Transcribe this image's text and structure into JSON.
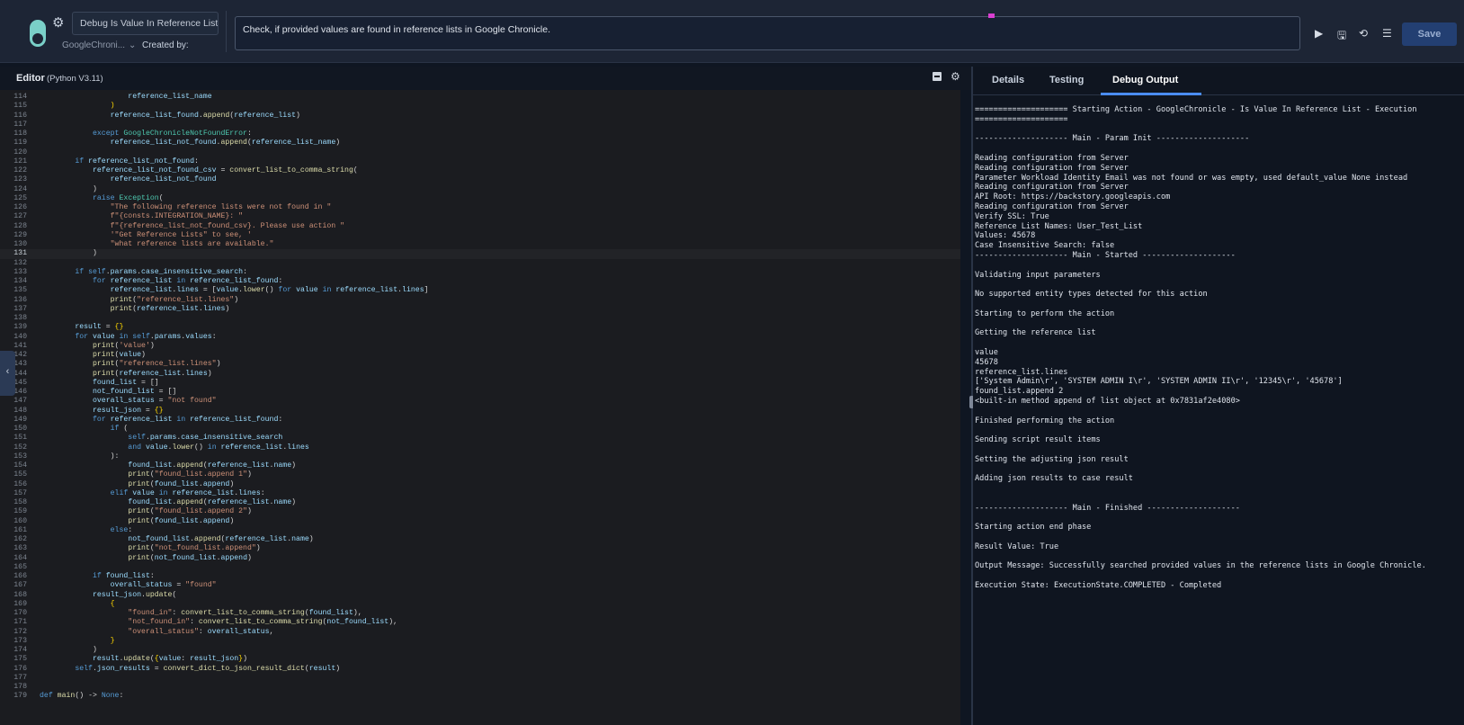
{
  "header": {
    "action_name": "Debug Is Value In Reference List",
    "integration": "GoogleChroni...",
    "created_by_label": "Created by:",
    "description": "Check, if provided values are found in reference lists in Google Chronicle.",
    "save_label": "Save",
    "icons": [
      "play-icon",
      "save-icon",
      "history-icon",
      "list-icon",
      "gear-icon",
      "chevron-down-icon"
    ]
  },
  "editor": {
    "title": "Editor",
    "subtitle": "(Python V3.11)",
    "code": [
      {
        "n": "114",
        "h": "                    <span class=\"vr\">reference_list_name</span>"
      },
      {
        "n": "115",
        "h": "                <span class=\"br\">)</span>"
      },
      {
        "n": "116",
        "h": "                <span class=\"vr\">reference_list_found</span>.<span class=\"fn\">append</span>(<span class=\"vr\">reference_list</span>)"
      },
      {
        "n": "117",
        "h": ""
      },
      {
        "n": "118",
        "h": "            <span class=\"kw\">except</span> <span class=\"cls\">GoogleChronicleNotFoundError</span>:"
      },
      {
        "n": "119",
        "h": "                <span class=\"vr\">reference_list_not_found</span>.<span class=\"fn\">append</span>(<span class=\"vr\">reference_list_name</span>)"
      },
      {
        "n": "120",
        "h": ""
      },
      {
        "n": "121",
        "h": "        <span class=\"kw\">if</span> <span class=\"vr\">reference_list_not_found</span>:"
      },
      {
        "n": "122",
        "h": "            <span class=\"vr\">reference_list_not_found_csv</span> = <span class=\"fn\">convert_list_to_comma_string</span>("
      },
      {
        "n": "123",
        "h": "                <span class=\"vr\">reference_list_not_found</span>"
      },
      {
        "n": "124",
        "h": "            )"
      },
      {
        "n": "125",
        "h": "            <span class=\"kw\">raise</span> <span class=\"cls\">Exception</span>("
      },
      {
        "n": "126",
        "h": "                <span class=\"st\">\"The following reference lists were not found in \"</span>"
      },
      {
        "n": "127",
        "h": "                <span class=\"st\">f\"{consts.INTEGRATION_NAME}: \"</span>"
      },
      {
        "n": "128",
        "h": "                <span class=\"st\">f\"{reference_list_not_found_csv}. Please use action \"</span>"
      },
      {
        "n": "129",
        "h": "                <span class=\"st\">'\"Get Reference Lists\" to see, '</span>"
      },
      {
        "n": "130",
        "h": "                <span class=\"st\">\"what reference lists are available.\"</span>"
      },
      {
        "n": "131",
        "h": "            )",
        "active": true
      },
      {
        "n": "132",
        "h": ""
      },
      {
        "n": "133",
        "h": "        <span class=\"kw\">if</span> <span class=\"kw\">self</span>.<span class=\"vr\">params</span>.<span class=\"vr\">case_insensitive_search</span>:"
      },
      {
        "n": "134",
        "h": "            <span class=\"kw\">for</span> <span class=\"vr\">reference_list</span> <span class=\"kw\">in</span> <span class=\"vr\">reference_list_found</span>:"
      },
      {
        "n": "135",
        "h": "                <span class=\"vr\">reference_list</span>.<span class=\"vr\">lines</span> = [<span class=\"vr\">value</span>.<span class=\"fn\">lower</span>() <span class=\"kw\">for</span> <span class=\"vr\">value</span> <span class=\"kw\">in</span> <span class=\"vr\">reference_list</span>.<span class=\"vr\">lines</span>]"
      },
      {
        "n": "136",
        "h": "                <span class=\"fn\">print</span>(<span class=\"st\">\"reference_list.lines\"</span>)"
      },
      {
        "n": "137",
        "h": "                <span class=\"fn\">print</span>(<span class=\"vr\">reference_list</span>.<span class=\"vr\">lines</span>)"
      },
      {
        "n": "138",
        "h": ""
      },
      {
        "n": "139",
        "h": "        <span class=\"vr\">result</span> = <span class=\"br\">{}</span>"
      },
      {
        "n": "140",
        "h": "        <span class=\"kw\">for</span> <span class=\"vr\">value</span> <span class=\"kw\">in</span> <span class=\"kw\">self</span>.<span class=\"vr\">params</span>.<span class=\"vr\">values</span>:"
      },
      {
        "n": "141",
        "h": "            <span class=\"fn\">print</span>(<span class=\"st\">'value'</span>)"
      },
      {
        "n": "142",
        "h": "            <span class=\"fn\">print</span>(<span class=\"vr\">value</span>)"
      },
      {
        "n": "143",
        "h": "            <span class=\"fn\">print</span>(<span class=\"st\">\"reference_list.lines\"</span>)"
      },
      {
        "n": "144",
        "h": "            <span class=\"fn\">print</span>(<span class=\"vr\">reference_list</span>.<span class=\"vr\">lines</span>)"
      },
      {
        "n": "145",
        "h": "            <span class=\"vr\">found_list</span> = []"
      },
      {
        "n": "146",
        "h": "            <span class=\"vr\">not_found_list</span> = []"
      },
      {
        "n": "147",
        "h": "            <span class=\"vr\">overall_status</span> = <span class=\"st\">\"not found\"</span>"
      },
      {
        "n": "148",
        "h": "            <span class=\"vr\">result_json</span> = <span class=\"br\">{}</span>"
      },
      {
        "n": "149",
        "h": "            <span class=\"kw\">for</span> <span class=\"vr\">reference_list</span> <span class=\"kw\">in</span> <span class=\"vr\">reference_list_found</span>:"
      },
      {
        "n": "150",
        "h": "                <span class=\"kw\">if</span> ("
      },
      {
        "n": "151",
        "h": "                    <span class=\"kw\">self</span>.<span class=\"vr\">params</span>.<span class=\"vr\">case_insensitive_search</span>"
      },
      {
        "n": "152",
        "h": "                    <span class=\"kw\">and</span> <span class=\"vr\">value</span>.<span class=\"fn\">lower</span>() <span class=\"kw\">in</span> <span class=\"vr\">reference_list</span>.<span class=\"vr\">lines</span>"
      },
      {
        "n": "153",
        "h": "                ):"
      },
      {
        "n": "154",
        "h": "                    <span class=\"vr\">found_list</span>.<span class=\"fn\">append</span>(<span class=\"vr\">reference_list</span>.<span class=\"vr\">name</span>)"
      },
      {
        "n": "155",
        "h": "                    <span class=\"fn\">print</span>(<span class=\"st\">\"found_list.append 1\"</span>)"
      },
      {
        "n": "156",
        "h": "                    <span class=\"fn\">print</span>(<span class=\"vr\">found_list</span>.<span class=\"vr\">append</span>)"
      },
      {
        "n": "157",
        "h": "                <span class=\"kw\">elif</span> <span class=\"vr\">value</span> <span class=\"kw\">in</span> <span class=\"vr\">reference_list</span>.<span class=\"vr\">lines</span>:"
      },
      {
        "n": "158",
        "h": "                    <span class=\"vr\">found_list</span>.<span class=\"fn\">append</span>(<span class=\"vr\">reference_list</span>.<span class=\"vr\">name</span>)"
      },
      {
        "n": "159",
        "h": "                    <span class=\"fn\">print</span>(<span class=\"st\">\"found_list.append 2\"</span>)"
      },
      {
        "n": "160",
        "h": "                    <span class=\"fn\">print</span>(<span class=\"vr\">found_list</span>.<span class=\"vr\">append</span>)"
      },
      {
        "n": "161",
        "h": "                <span class=\"kw\">else</span>:"
      },
      {
        "n": "162",
        "h": "                    <span class=\"vr\">not_found_list</span>.<span class=\"fn\">append</span>(<span class=\"vr\">reference_list</span>.<span class=\"vr\">name</span>)"
      },
      {
        "n": "163",
        "h": "                    <span class=\"fn\">print</span>(<span class=\"st\">\"not_found_list.append\"</span>)"
      },
      {
        "n": "164",
        "h": "                    <span class=\"fn\">print</span>(<span class=\"vr\">not_found_list</span>.<span class=\"vr\">append</span>)"
      },
      {
        "n": "165",
        "h": ""
      },
      {
        "n": "166",
        "h": "            <span class=\"kw\">if</span> <span class=\"vr\">found_list</span>:"
      },
      {
        "n": "167",
        "h": "                <span class=\"vr\">overall_status</span> = <span class=\"st\">\"found\"</span>"
      },
      {
        "n": "168",
        "h": "            <span class=\"vr\">result_json</span>.<span class=\"fn\">update</span>("
      },
      {
        "n": "169",
        "h": "                <span class=\"br\">{</span>"
      },
      {
        "n": "170",
        "h": "                    <span class=\"st\">\"found_in\"</span>: <span class=\"fn\">convert_list_to_comma_string</span>(<span class=\"vr\">found_list</span>),"
      },
      {
        "n": "171",
        "h": "                    <span class=\"st\">\"not_found_in\"</span>: <span class=\"fn\">convert_list_to_comma_string</span>(<span class=\"vr\">not_found_list</span>),"
      },
      {
        "n": "172",
        "h": "                    <span class=\"st\">\"overall_status\"</span>: <span class=\"vr\">overall_status</span>,"
      },
      {
        "n": "173",
        "h": "                <span class=\"br\">}</span>"
      },
      {
        "n": "174",
        "h": "            )"
      },
      {
        "n": "175",
        "h": "            <span class=\"vr\">result</span>.<span class=\"fn\">update</span>(<span class=\"br\">{</span><span class=\"vr\">value</span>: <span class=\"vr\">result_json</span><span class=\"br\">}</span>)"
      },
      {
        "n": "176",
        "h": "        <span class=\"kw\">self</span>.<span class=\"vr\">json_results</span> = <span class=\"fn\">convert_dict_to_json_result_dict</span>(<span class=\"vr\">result</span>)"
      },
      {
        "n": "177",
        "h": ""
      },
      {
        "n": "178",
        "h": ""
      },
      {
        "n": "179",
        "h": "<span class=\"kw\">def</span> <span class=\"fn\">main</span>() -> <span class=\"kw\">None</span>:"
      }
    ]
  },
  "right_panel": {
    "tabs": [
      "Details",
      "Testing",
      "Debug Output"
    ],
    "active_tab": "Debug Output",
    "debug_lines": [
      "==================== Starting Action - GoogleChronicle - Is Value In Reference List - Execution",
      "====================",
      "",
      "-------------------- Main - Param Init --------------------",
      "",
      "Reading configuration from Server",
      "Reading configuration from Server",
      "Parameter Workload Identity Email was not found or was empty, used default_value None instead",
      "Reading configuration from Server",
      "API Root: https://backstory.googleapis.com",
      "Reading configuration from Server",
      "Verify SSL: True",
      "Reference List Names: User_Test_List",
      "Values: 45678",
      "Case Insensitive Search: false",
      "-------------------- Main - Started --------------------",
      "",
      "Validating input parameters",
      "",
      "No supported entity types detected for this action",
      "",
      "Starting to perform the action",
      "",
      "Getting the reference list",
      "",
      "value",
      "45678",
      "reference_list.lines",
      "['System Admin\\r', 'SYSTEM ADMIN I\\r', 'SYSTEM ADMIN II\\r', '12345\\r', '45678']",
      "found_list.append 2",
      "<built-in method append of list object at 0x7831af2e4080>",
      "",
      "Finished performing the action",
      "",
      "Sending script result items",
      "",
      "Setting the adjusting json result",
      "",
      "Adding json results to case result",
      "",
      "",
      "-------------------- Main - Finished --------------------",
      "",
      "Starting action end phase",
      "",
      "Result Value: True",
      "",
      "Output Message: Successfully searched provided values in the reference lists in Google Chronicle.",
      "",
      "Execution State: ExecutionState.COMPLETED - Completed"
    ]
  }
}
